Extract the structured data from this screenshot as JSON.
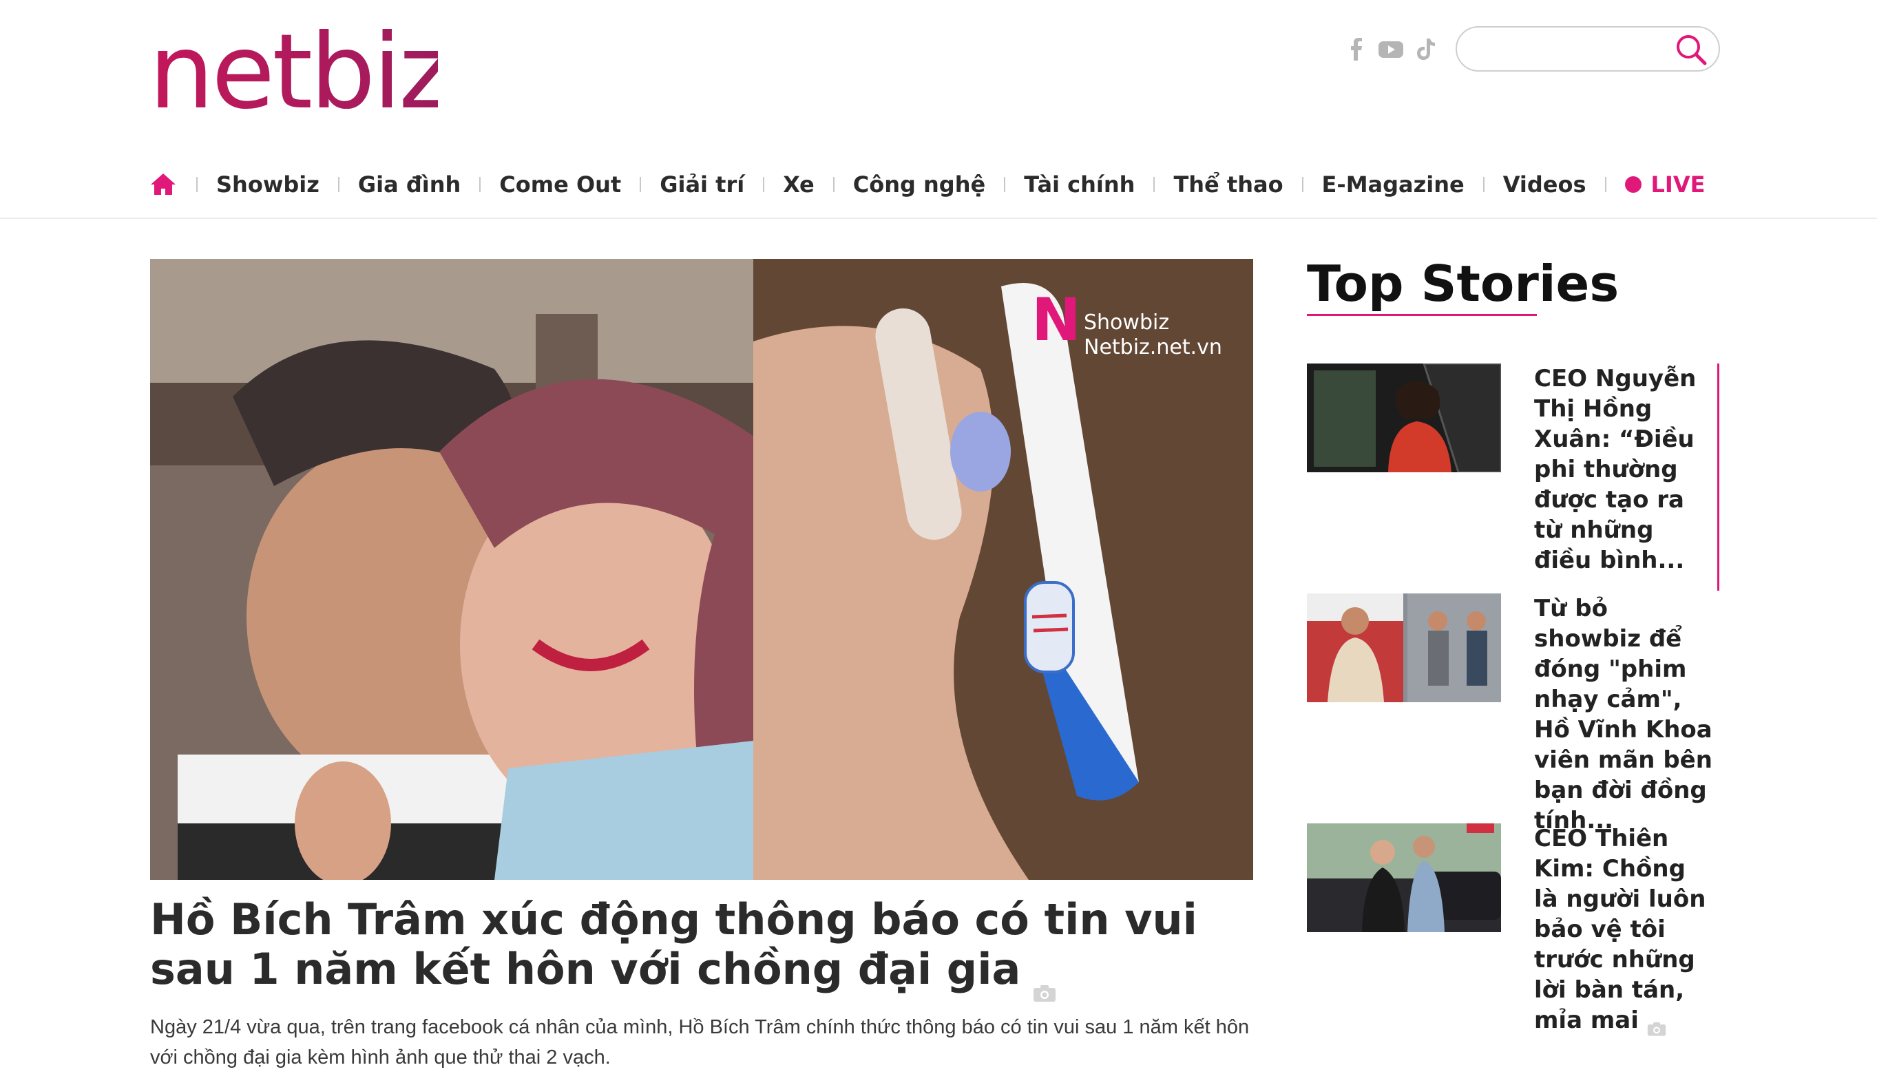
{
  "site": {
    "logo_text": "netbiz",
    "search_placeholder": ""
  },
  "social": [
    "facebook-icon",
    "youtube-icon",
    "tiktok-icon"
  ],
  "nav": {
    "items": [
      "Showbiz",
      "Gia đình",
      "Come Out",
      "Giải trí",
      "Xe",
      "Công nghệ",
      "Tài chính",
      "Thể thao",
      "E-Magazine",
      "Videos"
    ],
    "live_label": "LIVE"
  },
  "featured": {
    "watermark_section": "Showbiz",
    "watermark_site": "Netbiz.net.vn",
    "title": "Hồ Bích Trâm xúc động thông báo có tin vui sau 1 năm kết hôn với chồng đại gia",
    "sapo": "Ngày 21/4 vừa qua, trên trang facebook cá nhân của mình, Hồ Bích Trâm chính thức thông báo có tin vui sau 1 năm kết hôn với chồng đại gia kèm hình ảnh que thử thai 2 vạch."
  },
  "top_stories": {
    "heading": "Top Stories",
    "items": [
      {
        "title": "CEO Nguyễn Thị Hồng Xuân: “Điều phi thường được tạo ra từ những điều bình...",
        "has_photo_icon": false
      },
      {
        "title": "Từ bỏ showbiz để đóng \"phim nhạy cảm\", Hồ Vĩnh Khoa viên mãn bên bạn đời đồng tính...",
        "has_photo_icon": false
      },
      {
        "title": "CEO Thiên Kim: Chồng là người luôn bảo vệ tôi trước những lời bàn tán, mỉa mai",
        "has_photo_icon": true
      }
    ]
  },
  "colors": {
    "brand_pink": "#e0187a",
    "text_dark": "#2b2b2b"
  }
}
